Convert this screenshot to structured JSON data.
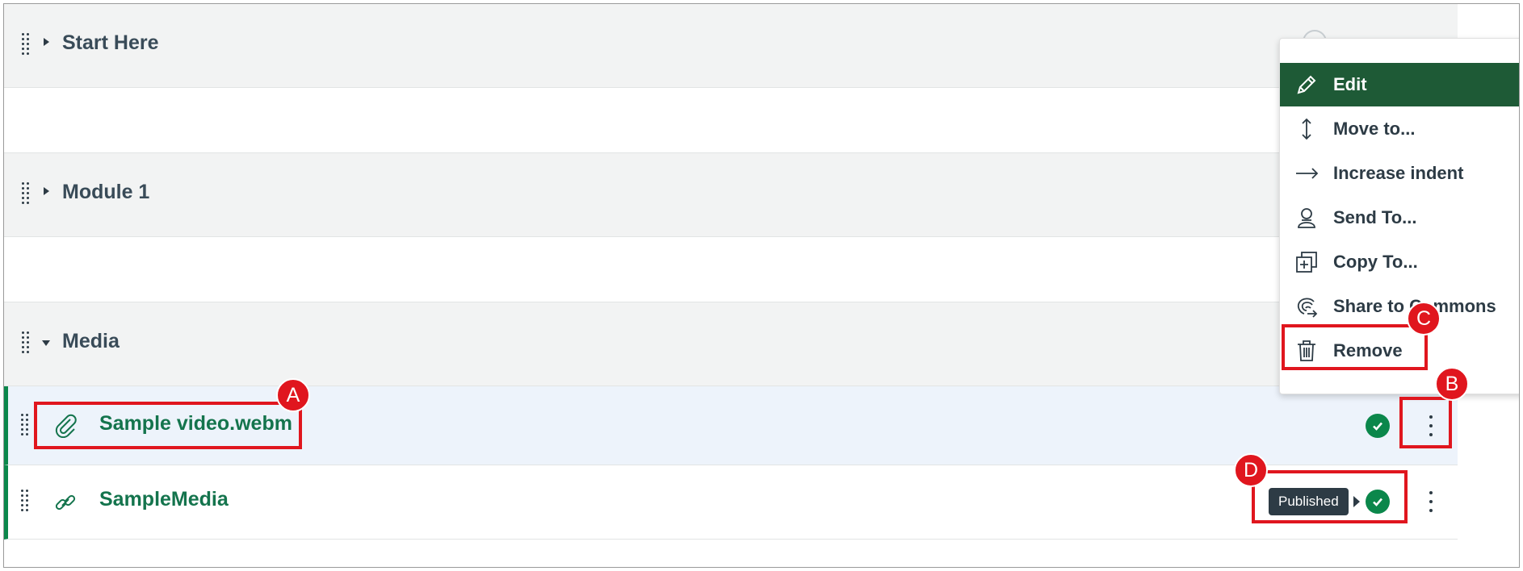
{
  "modules": [
    {
      "title": "Start Here",
      "expanded": false
    },
    {
      "title": "Module 1",
      "expanded": false
    },
    {
      "title": "Media",
      "expanded": true
    }
  ],
  "items": [
    {
      "title": "Sample video.webm",
      "icon": "paperclip-icon",
      "status": "published"
    },
    {
      "title": "SampleMedia",
      "icon": "link-icon",
      "status": "published"
    }
  ],
  "tooltip": {
    "text": "Published"
  },
  "menu": {
    "items": [
      {
        "label": "Edit",
        "icon": "pencil-icon",
        "active": true
      },
      {
        "label": "Move to...",
        "icon": "move-vertical-icon"
      },
      {
        "label": "Increase indent",
        "icon": "arrow-right-icon"
      },
      {
        "label": "Send To...",
        "icon": "user-send-icon"
      },
      {
        "label": "Copy To...",
        "icon": "copy-plus-icon"
      },
      {
        "label": "Share to Commons",
        "icon": "commons-icon"
      },
      {
        "label": "Remove",
        "icon": "trash-icon"
      }
    ]
  },
  "annotations": {
    "a": "A",
    "b": "B",
    "c": "C",
    "d": "D"
  },
  "colors": {
    "accent_green": "#0b874b",
    "title_green": "#14744d",
    "menu_active": "#1e5a36",
    "annotation_red": "#e0161e",
    "module_header_bg": "#f2f3f3",
    "highlight_row_bg": "#edf3fb"
  }
}
